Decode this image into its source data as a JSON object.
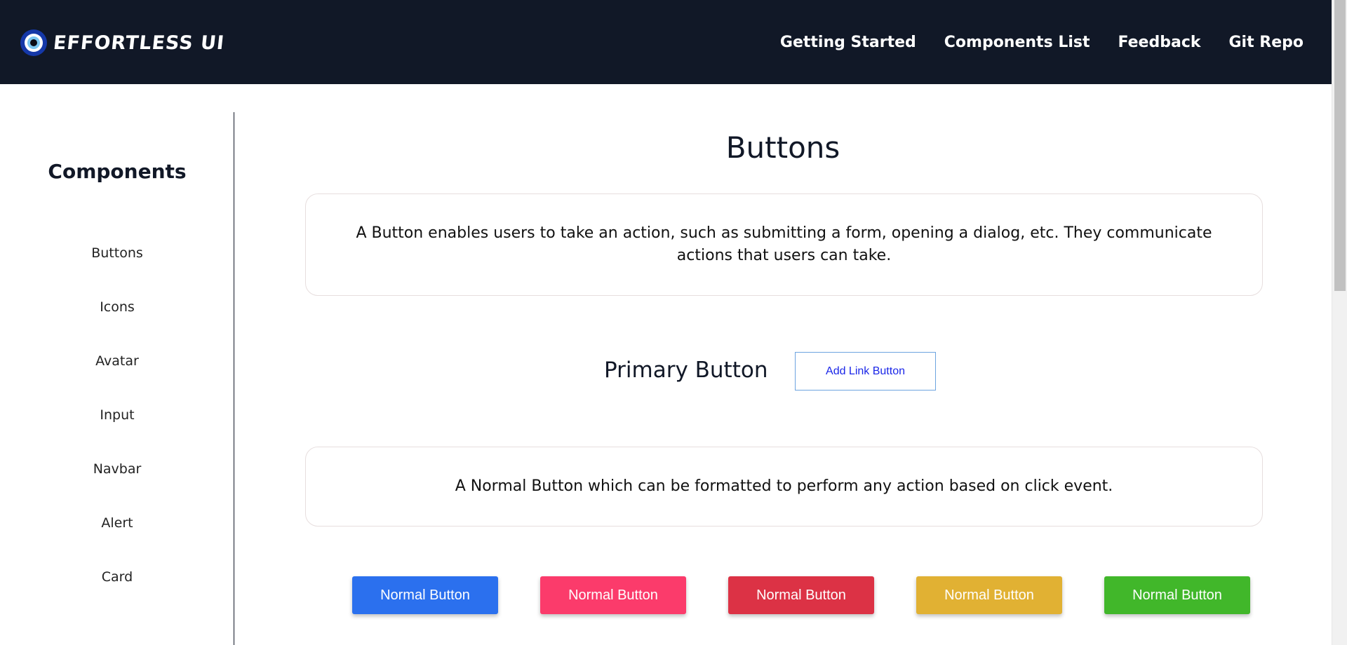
{
  "header": {
    "brand": "EFFORTLESS UI",
    "logo_icon": "eye-icon",
    "nav": [
      {
        "label": "Getting Started"
      },
      {
        "label": "Components List"
      },
      {
        "label": "Feedback"
      },
      {
        "label": "Git Repo"
      }
    ],
    "colors": {
      "background": "#111827",
      "text": "#ffffff"
    }
  },
  "sidebar": {
    "title": "Components",
    "items": [
      {
        "label": "Buttons"
      },
      {
        "label": "Icons"
      },
      {
        "label": "Avatar"
      },
      {
        "label": "Input"
      },
      {
        "label": "Navbar"
      },
      {
        "label": "Alert"
      },
      {
        "label": "Card"
      }
    ]
  },
  "main": {
    "title": "Buttons",
    "intro": "A Button enables users to take an action, such as submitting a form, opening a dialog, etc. They communicate actions that users can take.",
    "primary": {
      "label": "Primary Button",
      "link_button": "Add Link Button"
    },
    "normal_description": "A Normal Button which can be formatted to perform any action based on click event.",
    "normal_buttons": [
      {
        "label": "Normal Button",
        "color": "#2b70ee"
      },
      {
        "label": "Normal Button",
        "color": "#fb3b6b"
      },
      {
        "label": "Normal Button",
        "color": "#dc3245"
      },
      {
        "label": "Normal Button",
        "color": "#e1b133"
      },
      {
        "label": "Normal Button",
        "color": "#41b72a"
      }
    ]
  }
}
